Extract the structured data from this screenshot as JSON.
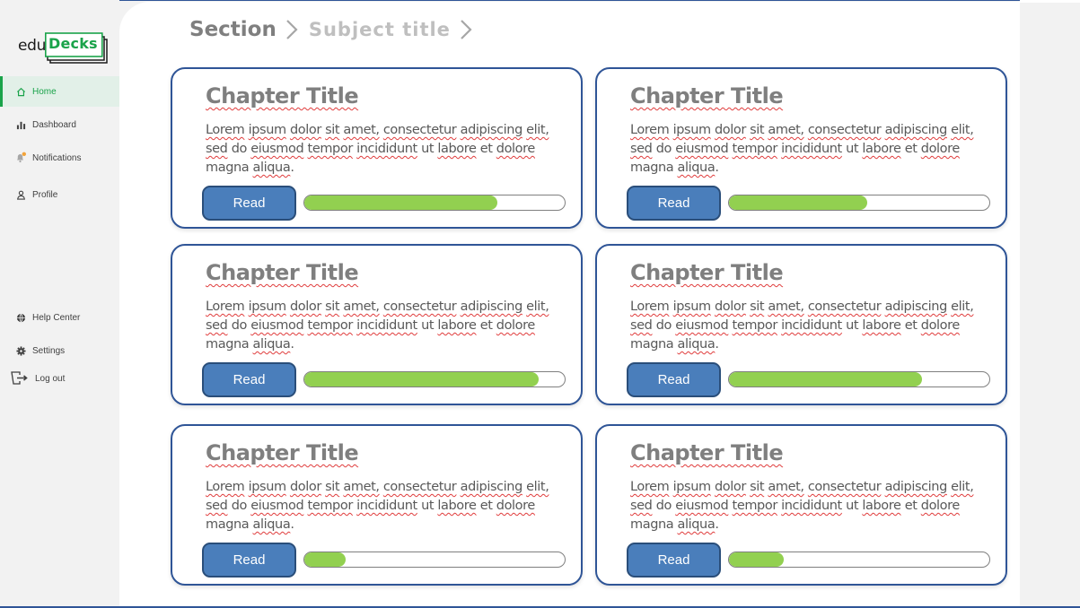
{
  "brand": {
    "prefix": "edu",
    "name": "Decks",
    "accent": "#1aa34a"
  },
  "sidebar": {
    "items": [
      {
        "label": "Home",
        "icon": "home-icon",
        "active": true
      },
      {
        "label": "Dashboard",
        "icon": "bar-chart-icon",
        "active": false
      },
      {
        "label": "Notifications",
        "icon": "bell-icon",
        "active": false
      },
      {
        "label": "Profile",
        "icon": "user-icon",
        "active": false
      }
    ],
    "bottom_items": [
      {
        "label": "Help Center",
        "icon": "globe-icon"
      },
      {
        "label": "Settings",
        "icon": "gear-icon"
      },
      {
        "label": "Log out",
        "icon": "logout-icon"
      }
    ]
  },
  "breadcrumb": {
    "section": "Section",
    "subject": "Subject title"
  },
  "cards": [
    {
      "title": "Chapter Title",
      "button": "Read",
      "progress": 0.74
    },
    {
      "title": "Chapter Title",
      "button": "Read",
      "progress": 0.53
    },
    {
      "title": "Chapter Title",
      "button": "Read",
      "progress": 0.9
    },
    {
      "title": "Chapter Title",
      "button": "Read",
      "progress": 0.74
    },
    {
      "title": "Chapter Title",
      "button": "Read",
      "progress": 0.16
    },
    {
      "title": "Chapter Title",
      "button": "Read",
      "progress": 0.21
    }
  ],
  "card_text": {
    "w1": "Lorem",
    "w2": "ipsum",
    "w3": "dolor",
    "w4": "sit",
    "w5": "amet,",
    "w6": "consectetur",
    "w7": "adipiscing",
    "w8": "elit,",
    "w9": "sed",
    "w10": "do",
    "w11": "eiusmod",
    "w12": "tempor",
    "w13": "incididunt",
    "w14": "ut",
    "w15": "labore",
    "w16": "et",
    "w17": "dolore",
    "w18": "magna",
    "w19": "aliqua",
    "w20": "."
  },
  "colors": {
    "card_border": "#2f5597",
    "button": "#4a7ebb",
    "progress": "#92d050"
  }
}
